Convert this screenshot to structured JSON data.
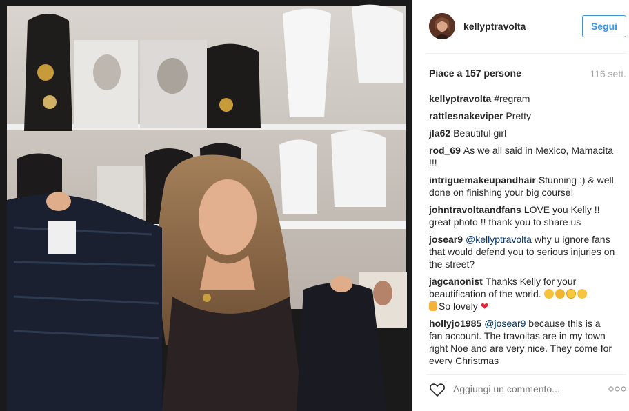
{
  "post": {
    "username": "kellyptravolta",
    "follow_label": "Segui",
    "likes_text": "Piace a 157 persone",
    "age": "116 sett."
  },
  "comments": [
    {
      "user": "kellyptravolta",
      "text": "#regram",
      "mention": ""
    },
    {
      "user": "rattlesnakeviper",
      "text": "Pretty",
      "mention": ""
    },
    {
      "user": "jla62",
      "text": "Beautiful girl",
      "mention": ""
    },
    {
      "user": "rod_69",
      "text": "As we all said in Mexico, Mamacita !!!",
      "mention": ""
    },
    {
      "user": "intriguemakeupandhair",
      "text": "Stunning :) & well done on finishing your big course!",
      "mention": ""
    },
    {
      "user": "johntravoltaandfans",
      "text": "LOVE you Kelly !! great photo !! thank you to share us",
      "mention": ""
    },
    {
      "user": "josear9",
      "text": "why u ignore fans that would defend you to serious injuries on the street?",
      "mention": "@kellyptravolta"
    },
    {
      "user": "jagcanonist",
      "text": "Thanks Kelly for your beautification of the world.",
      "text2": "So lovely",
      "mention": ""
    },
    {
      "user": "hollyjo1985",
      "text": "because this is a fan account. The travoltas are in my town right Noe and are very nice. They come for every Christmas",
      "mention": "@josear9"
    }
  ],
  "add_comment_placeholder": "Aggiungi un commento...",
  "icons": {
    "like": "heart-outline-icon",
    "more": "more-dots-icon"
  },
  "colors": {
    "follow": "#3897f0",
    "mention": "#003569",
    "muted": "#a5a5a5"
  }
}
